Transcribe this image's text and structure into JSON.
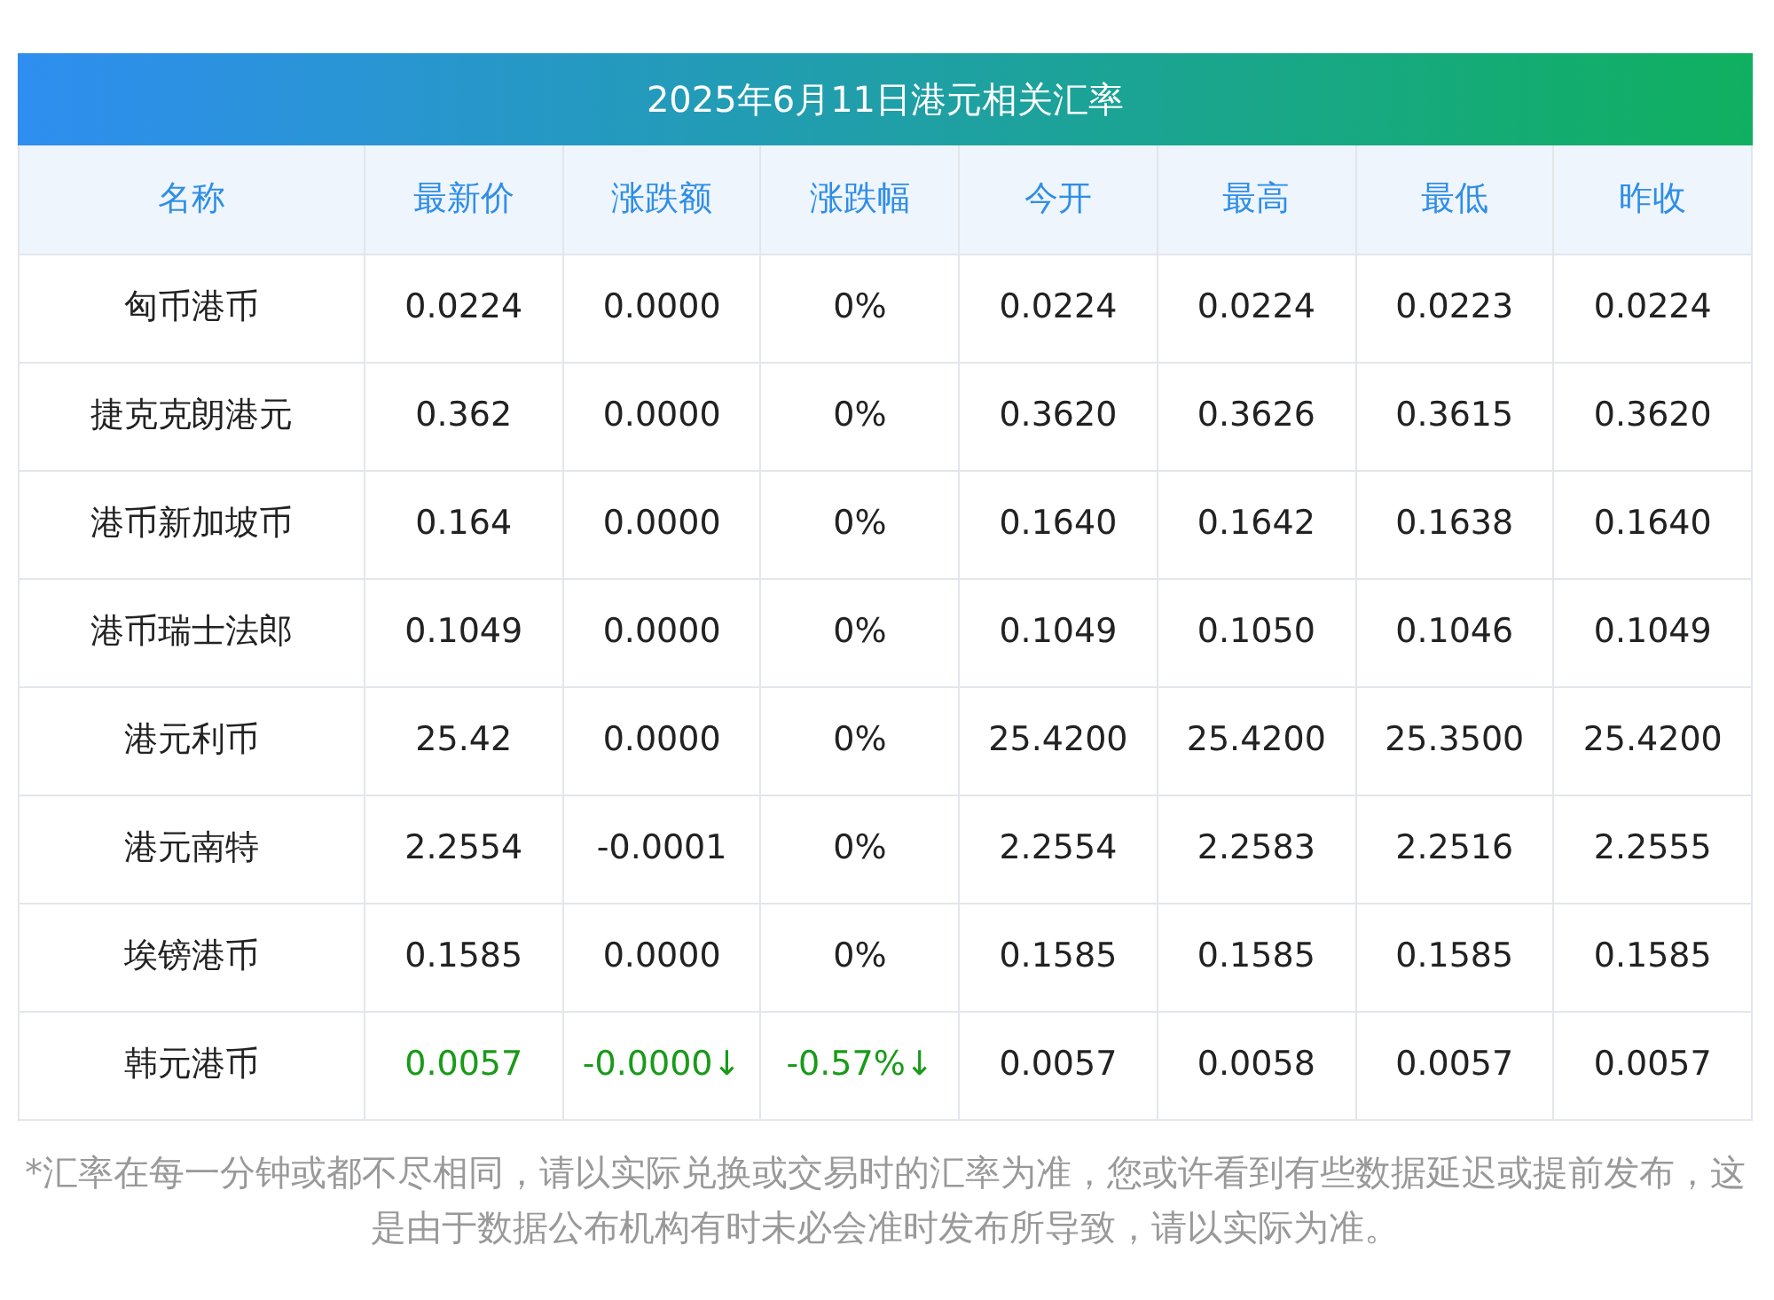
{
  "title": "2025年6月11日港元相关汇率",
  "columns": [
    "名称",
    "最新价",
    "涨跌额",
    "涨跌幅",
    "今开",
    "最高",
    "最低",
    "昨收"
  ],
  "rows": [
    {
      "kind": "flat",
      "cells": [
        "匈币港币",
        "0.0224",
        "0.0000",
        "0%",
        "0.0224",
        "0.0224",
        "0.0223",
        "0.0224"
      ]
    },
    {
      "kind": "flat",
      "cells": [
        "捷克克朗港元",
        "0.362",
        "0.0000",
        "0%",
        "0.3620",
        "0.3626",
        "0.3615",
        "0.3620"
      ]
    },
    {
      "kind": "flat",
      "cells": [
        "港币新加坡币",
        "0.164",
        "0.0000",
        "0%",
        "0.1640",
        "0.1642",
        "0.1638",
        "0.1640"
      ]
    },
    {
      "kind": "flat",
      "cells": [
        "港币瑞士法郎",
        "0.1049",
        "0.0000",
        "0%",
        "0.1049",
        "0.1050",
        "0.1046",
        "0.1049"
      ]
    },
    {
      "kind": "flat",
      "cells": [
        "港元利币",
        "25.42",
        "0.0000",
        "0%",
        "25.4200",
        "25.4200",
        "25.3500",
        "25.4200"
      ]
    },
    {
      "kind": "flat",
      "cells": [
        "港元南特",
        "2.2554",
        "-0.0001",
        "0%",
        "2.2554",
        "2.2583",
        "2.2516",
        "2.2555"
      ]
    },
    {
      "kind": "flat",
      "cells": [
        "埃镑港币",
        "0.1585",
        "0.0000",
        "0%",
        "0.1585",
        "0.1585",
        "0.1585",
        "0.1585"
      ]
    },
    {
      "kind": "down",
      "cells": [
        "韩元港币",
        "0.0057",
        "-0.0000↓",
        "-0.57%↓",
        "0.0057",
        "0.0058",
        "0.0057",
        "0.0057"
      ]
    }
  ],
  "footnote": "*汇率在每一分钟或都不尽相同，请以实际兑换或交易时的汇率为准，您或许看到有些数据延迟或提前发布，这是由于数据公布机构有时未必会准时发布所导致，请以实际为准。"
}
